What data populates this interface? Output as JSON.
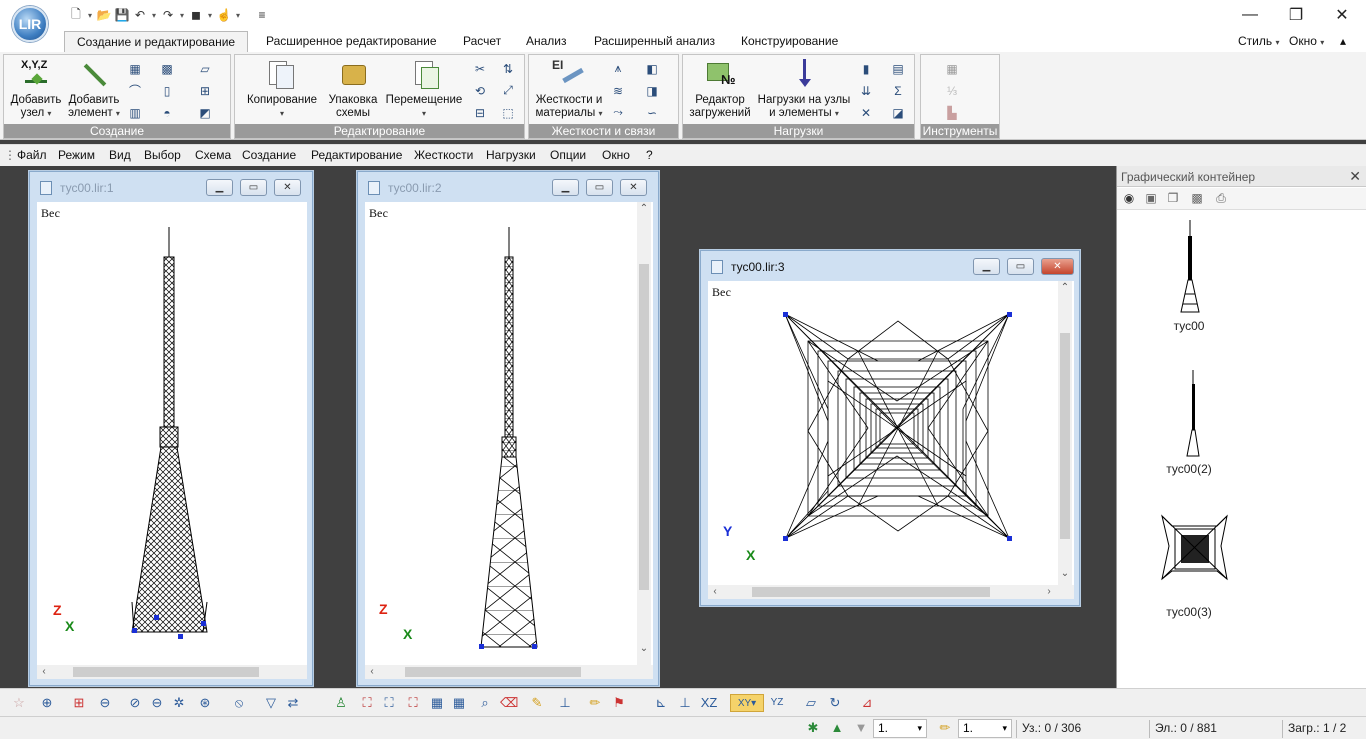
{
  "app": {
    "logo_text": "LIR"
  },
  "window_controls": {
    "minimize": "—",
    "maximize": "❐",
    "close": "✕"
  },
  "ribbon_tabs": [
    "Создание и редактирование",
    "Расширенное редактирование",
    "Расчет",
    "Анализ",
    "Расширенный анализ",
    "Конструирование"
  ],
  "ribbon_right": {
    "style": "Стиль",
    "window": "Окно"
  },
  "groups": {
    "create": {
      "label": "Создание",
      "add_node_icon_text": "X,Y,Z",
      "add_node_l1": "Добавить",
      "add_node_l2": "узел",
      "add_element_l1": "Добавить",
      "add_element_l2": "элемент"
    },
    "edit": {
      "label": "Редактирование",
      "copy": "Копирование",
      "pack_l1": "Упаковка",
      "pack_l2": "схемы",
      "move": "Перемещение"
    },
    "stiff": {
      "label": "Жесткости и связи",
      "stiff_icon_text": "EI",
      "stiff_l1": "Жесткости и",
      "stiff_l2": "материалы"
    },
    "loads": {
      "label": "Нагрузки",
      "editor_l1": "Редактор",
      "editor_l2": "загружений",
      "nodal_l1": "Нагрузки на узлы",
      "nodal_l2": "и элементы"
    },
    "tools": {
      "label": "Инструменты"
    }
  },
  "menu": [
    "Файл",
    "Режим",
    "Вид",
    "Выбор",
    "Схема",
    "Создание",
    "Редактирование",
    "Жесткости",
    "Нагрузки",
    "Опции",
    "Окно",
    "?"
  ],
  "windows": {
    "w1": {
      "title": "тус00.lir:1",
      "label": "Вес",
      "axis_v": "Z",
      "axis_h": "X"
    },
    "w2": {
      "title": "тус00.lir:2",
      "label": "Вес",
      "axis_v": "Z",
      "axis_h": "X"
    },
    "w3": {
      "title": "тус00.lir:3",
      "label": "Вес",
      "axis_v": "Y",
      "axis_h": "X"
    }
  },
  "graphics_container": {
    "title": "Графический контейнер",
    "items": [
      "тус00",
      "тус00(2)",
      "тус00(3)"
    ]
  },
  "status": {
    "field1": "1.",
    "field2": "1.",
    "nodes": "Уз.: 0 / 306",
    "elements": "Эл.: 0 / 881",
    "load": "Загр.: 1 / 2"
  }
}
